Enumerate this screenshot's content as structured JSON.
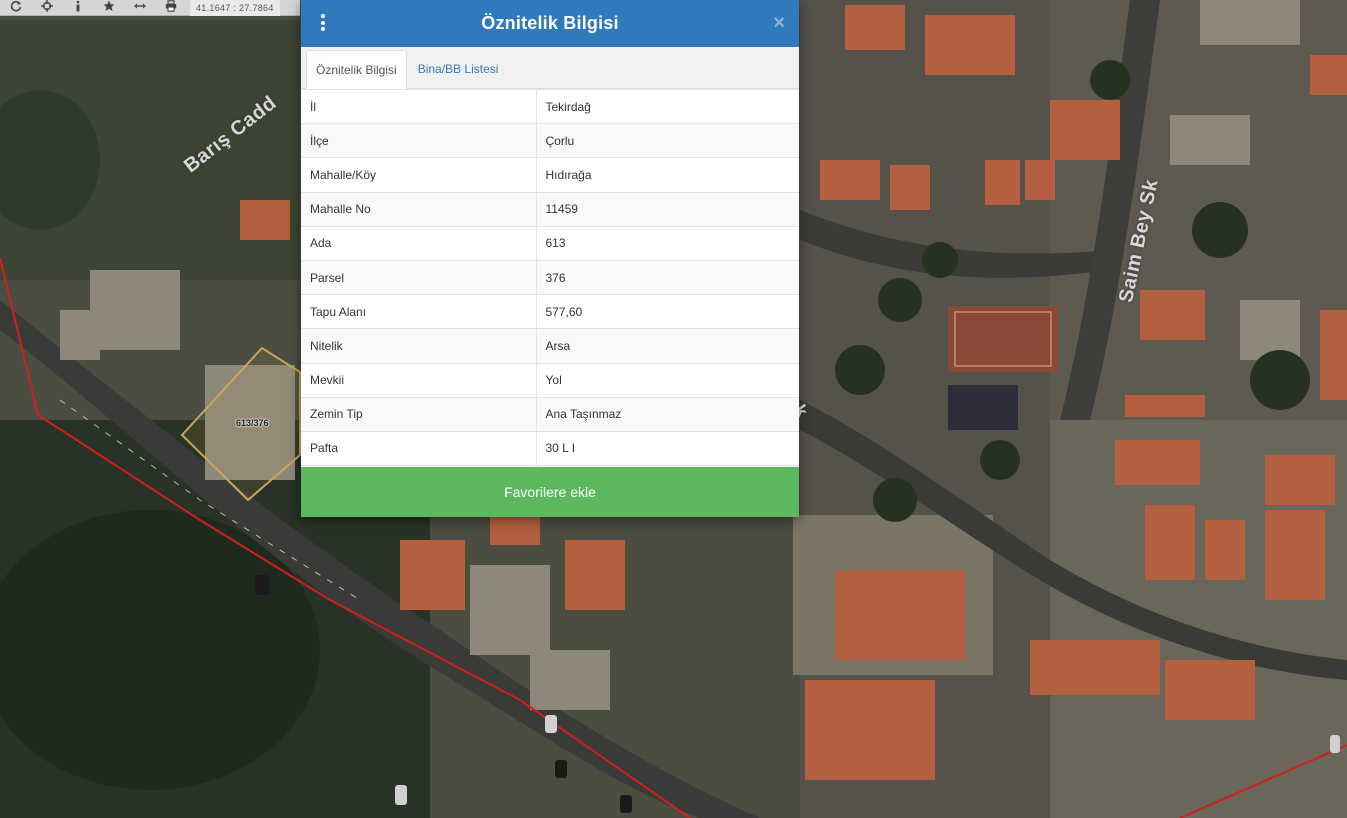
{
  "toolbar": {
    "tools": [
      {
        "name": "refresh-icon",
        "label": "refresh"
      },
      {
        "name": "crosshair-icon",
        "label": "locate"
      },
      {
        "name": "info-icon",
        "label": "info"
      },
      {
        "name": "star-icon",
        "label": "favorites"
      },
      {
        "name": "measure-icon",
        "label": "measure"
      },
      {
        "name": "print-icon",
        "label": "print"
      }
    ],
    "coordinates": "41.1647 : 27.7864"
  },
  "map": {
    "parcel_label": "613/376",
    "street_labels": [
      "Barış Cadd",
      "Saim Bey Sk",
      "ok"
    ]
  },
  "dialog": {
    "title": "Öznitelik Bilgisi",
    "close_symbol": "×",
    "tabs": [
      {
        "label": "Öznitelik Bilgisi",
        "active": true
      },
      {
        "label": "Bina/BB Listesi",
        "active": false
      }
    ],
    "rows": [
      {
        "key": "İl",
        "value": "Tekirdağ"
      },
      {
        "key": "İlçe",
        "value": "Çorlu"
      },
      {
        "key": "Mahalle/Köy",
        "value": "Hıdırağa"
      },
      {
        "key": "Mahalle No",
        "value": "11459"
      },
      {
        "key": "Ada",
        "value": "613"
      },
      {
        "key": "Parsel",
        "value": "376"
      },
      {
        "key": "Tapu Alanı",
        "value": "577,60"
      },
      {
        "key": "Nitelik",
        "value": "Arsa"
      },
      {
        "key": "Mevkii",
        "value": "Yol"
      },
      {
        "key": "Zemin Tip",
        "value": "Ana Taşınmaz"
      },
      {
        "key": "Pafta",
        "value": "30 L I"
      }
    ],
    "favorite_button": "Favorilere ekle"
  },
  "colors": {
    "header_blue": "#3179bd",
    "favorite_green": "#5cb85c",
    "parcel_outline": "#c8a85a",
    "boundary_red": "#d0201c"
  }
}
